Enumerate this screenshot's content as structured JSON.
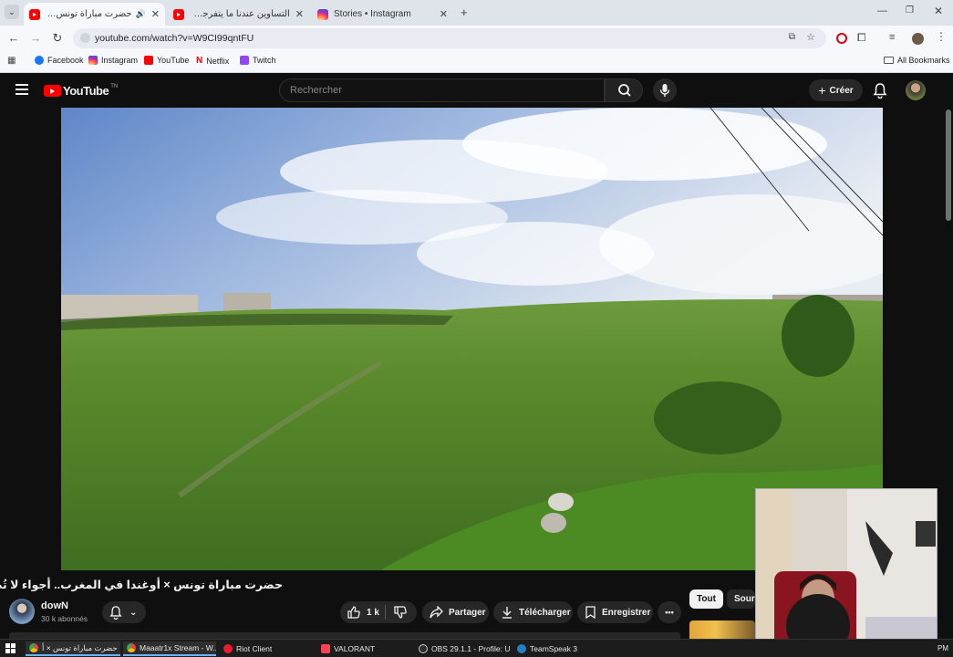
{
  "browser": {
    "tabs": [
      {
        "title": "حضرت مباراة تونس × أوغندا",
        "icon": "youtube-icon",
        "active": true,
        "audio": true
      },
      {
        "title": "التساوين عندنا ما يتفرجش غير ك",
        "icon": "youtube-icon",
        "active": false
      },
      {
        "title": "Stories • Instagram",
        "icon": "instagram-icon",
        "active": false
      }
    ],
    "new_tab": "+",
    "url": "youtube.com/watch?v=W9CI99qntFU",
    "bookmarks": [
      {
        "label": "Facebook",
        "color": "#1877f2"
      },
      {
        "label": "Instagram",
        "color": "#d6249f"
      },
      {
        "label": "YouTube",
        "color": "#ff0000"
      },
      {
        "label": "Netflix",
        "color": "#e50914"
      },
      {
        "label": "Twitch",
        "color": "#9146ff"
      }
    ],
    "all_bookmarks": "All Bookmarks"
  },
  "youtube": {
    "logo_text": "YouTube",
    "country_code": "TN",
    "search_placeholder": "Rechercher",
    "create_label": "Créer",
    "video_title": "حضرت مباراة تونس × أوغندا في المغرب.. أجواء لا تُصدَّق🔥",
    "channel_name": "dowN",
    "subscribers": "30 k abonnés",
    "like_count": "1 k",
    "share_label": "Partager",
    "download_label": "Télécharger",
    "save_label": "Enregistrer",
    "more_label": "•••",
    "chips": [
      "Tout",
      "Sourc"
    ]
  },
  "taskbar": {
    "items": [
      {
        "label": "حضرت مباراة تونس × أ",
        "color": "#4285f4"
      },
      {
        "label": "Maaatr1x Stream - W...",
        "color": "#4285f4"
      },
      {
        "label": "Riot Client",
        "color": "#ea1c2e"
      },
      {
        "label": "VALORANT",
        "color": "#fa4454"
      },
      {
        "label": "OBS 29.1.1 - Profile: U...",
        "color": "#302e31"
      },
      {
        "label": "TeamSpeak 3",
        "color": "#2580c3"
      }
    ],
    "clock_fragment": "PM"
  },
  "colors": {
    "yt_red": "#ff0000",
    "yt_bg": "#0f0f0f",
    "chip_active_bg": "#f1f1f1",
    "taskbar_accent": "#6ab4ff"
  }
}
